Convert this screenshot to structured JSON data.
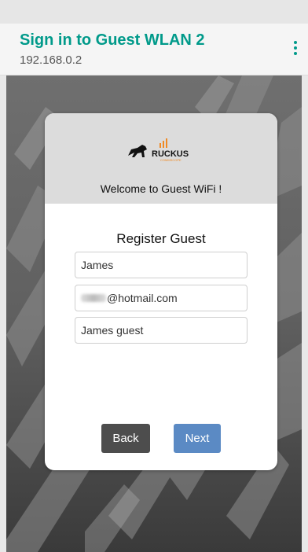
{
  "header": {
    "title": "Sign in to Guest WLAN 2",
    "subtitle": "192.168.0.2",
    "menu_icon": "more-vert-icon"
  },
  "card": {
    "logo_text": "RUCKUS",
    "logo_subtext": "COMMSCOPE",
    "welcome": "Welcome to Guest WiFi !",
    "form_title": "Register Guest",
    "fields": {
      "name_value": "James",
      "email_value": "@hotmail.com",
      "description_value": "James guest"
    },
    "back_label": "Back",
    "next_label": "Next"
  },
  "colors": {
    "accent": "#009a8a",
    "ruckus_orange": "#f08a24",
    "back_button": "#4d4d4d",
    "next_button": "#5b8ac4"
  }
}
